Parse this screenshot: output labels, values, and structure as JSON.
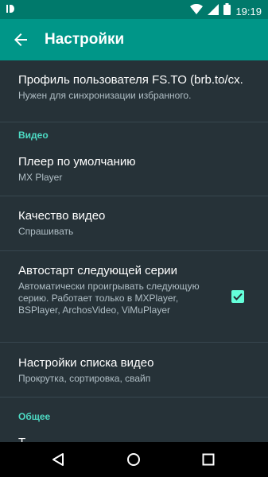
{
  "status_bar": {
    "left_icon": "notification-icon",
    "time": "19:19",
    "icons": [
      "wifi-icon",
      "signal-icon",
      "battery-icon"
    ]
  },
  "app_bar": {
    "title": "Настройки",
    "back_icon": "arrow-back-icon"
  },
  "settings": {
    "items": [
      {
        "title": "Профиль пользователя FS.TO (brb.to/cx.",
        "summary": "Нужен для синхронизации избранного."
      },
      {
        "title": "Плеер по умолчанию",
        "summary": "MX Player"
      },
      {
        "title": "Качество видео",
        "summary": "Спрашивать"
      },
      {
        "title": "Автостарт следующей серии",
        "summary": "Автоматически проигрывать следующую серию. Работает только в MXPlayer, BSPlayer, ArchosVideo, ViMuPlayer",
        "checked": true
      },
      {
        "title": "Настройки списка видео",
        "summary": "Прокрутка, сортировка, свайп"
      },
      {
        "title": "Т"
      }
    ],
    "sections": {
      "video": "Видео",
      "general": "Общее"
    }
  },
  "nav_bar": {
    "icons": [
      "back-triangle-icon",
      "home-circle-icon",
      "recents-square-icon"
    ]
  },
  "colors": {
    "status_bar": "#00796b",
    "app_bar": "#009688",
    "background": "#263238",
    "accent": "#64ffda",
    "section": "#4ddbc4"
  }
}
